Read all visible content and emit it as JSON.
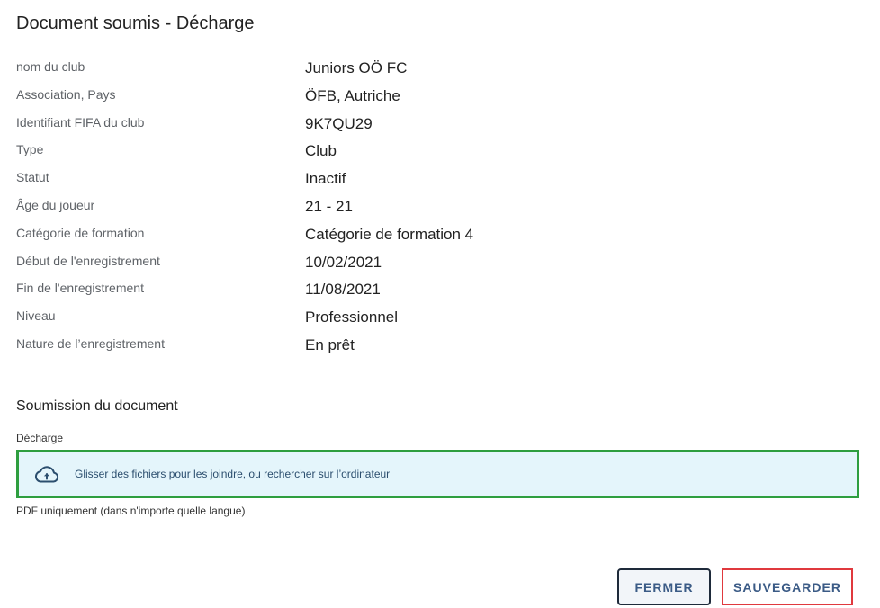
{
  "title": "Document soumis - Décharge",
  "details": [
    {
      "label": "nom du club",
      "value": "Juniors OÖ FC"
    },
    {
      "label": "Association, Pays",
      "value": "ÖFB, Autriche"
    },
    {
      "label": "Identifiant FIFA du club",
      "value": "9K7QU29"
    },
    {
      "label": "Type",
      "value": "Club"
    },
    {
      "label": "Statut",
      "value": "Inactif"
    },
    {
      "label": "Âge du joueur",
      "value": "21 - 21"
    },
    {
      "label": "Catégorie de formation",
      "value": "Catégorie de formation 4"
    },
    {
      "label": "Début de l'enregistrement",
      "value": "10/02/2021"
    },
    {
      "label": "Fin de l'enregistrement",
      "value": "11/08/2021"
    },
    {
      "label": "Niveau",
      "value": "Professionnel"
    },
    {
      "label": "Nature de l’enregistrement",
      "value": "En prêt"
    }
  ],
  "submission": {
    "section_title": "Soumission du document",
    "field_label": "Décharge",
    "dropzone_text": "Glisser des fichiers pour les joindre, ou rechercher sur l’ordinateur",
    "dropzone_icon": "cloud-upload-icon",
    "help_text": "PDF uniquement (dans n'importe quelle langue)"
  },
  "actions": {
    "close_label": "FERMER",
    "save_label": "SAUVEGARDER"
  },
  "colors": {
    "accent": "#3b5b86",
    "dropzone_bg": "#e4f5fb",
    "dropzone_border": "#2e9e3f",
    "save_border": "#e0393e"
  }
}
